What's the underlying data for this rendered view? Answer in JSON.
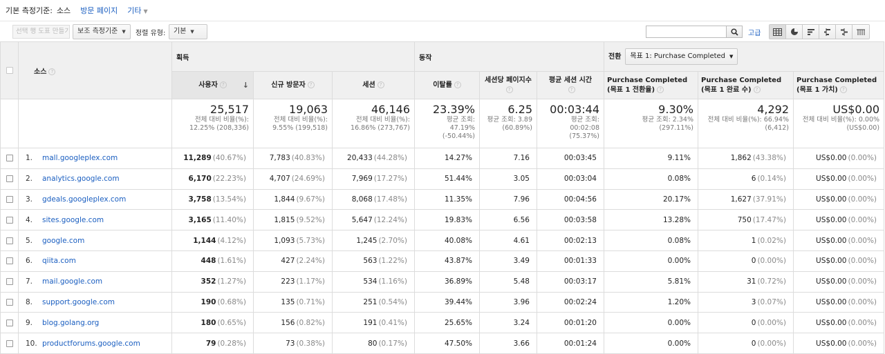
{
  "topbar": {
    "primary_dimension_label": "기본 측정기준:",
    "primary_dimension_current": "소스",
    "link_landing": "방문 페이지",
    "link_other": "기타"
  },
  "toolbar": {
    "create_row_chart": "선택 행 도표 만들기",
    "secondary_dimension": "보조 측정기준",
    "sort_type_label": "정렬 유형:",
    "sort_type_value": "기본",
    "search_placeholder": "",
    "advanced_link": "고급",
    "view_icons": [
      "table-view-icon",
      "pie-view-icon",
      "performance-view-icon",
      "comparison-view-icon",
      "term-cloud-view-icon",
      "pivot-view-icon"
    ]
  },
  "table": {
    "source_header": "소스",
    "groups": {
      "acquisition": "획득",
      "behavior": "동작",
      "conversion": "전환",
      "goal_select": "목표 1: Purchase Completed"
    },
    "columns": [
      "사용자",
      "신규 방문자",
      "세션",
      "이탈률",
      "세션당 페이지수",
      "평균 세션 시간",
      "Purchase Completed (목표 1 전환율)",
      "Purchase Completed (목표 1 완료 수)",
      "Purchase Completed (목표 1 가치)"
    ],
    "totals": [
      {
        "value": "25,517",
        "sub1": "전체 대비 비율(%):",
        "sub2": "12.25% (208,336)",
        "sub3": ""
      },
      {
        "value": "19,063",
        "sub1": "전체 대비 비율(%):",
        "sub2": "9.55% (199,518)",
        "sub3": ""
      },
      {
        "value": "46,146",
        "sub1": "전체 대비 비율(%):",
        "sub2": "16.86% (273,767)",
        "sub3": ""
      },
      {
        "value": "23.39%",
        "sub1": "평균 조회:",
        "sub2": "47.19%",
        "sub3": "(-50.44%)"
      },
      {
        "value": "6.25",
        "sub1": "평균 조회: 3.89",
        "sub2": "(60.89%)",
        "sub3": ""
      },
      {
        "value": "00:03:44",
        "sub1": "평균 조회:",
        "sub2": "00:02:08",
        "sub3": "(75.37%)"
      },
      {
        "value": "9.30%",
        "sub1": "평균 조회: 2.34%",
        "sub2": "(297.11%)",
        "sub3": ""
      },
      {
        "value": "4,292",
        "sub1": "전체 대비 비율(%): 66.94%",
        "sub2": "(6,412)",
        "sub3": ""
      },
      {
        "value": "US$0.00",
        "sub1": "전체 대비 비율(%): 0.00%",
        "sub2": "(US$0.00)",
        "sub3": ""
      }
    ],
    "rows": [
      {
        "idx": "1.",
        "source": "mall.googleplex.com",
        "users": "11,289",
        "users_pct": "(40.67%)",
        "new": "7,783",
        "new_pct": "(40.83%)",
        "sessions": "20,433",
        "sessions_pct": "(44.28%)",
        "bounce": "14.27%",
        "pps": "7.16",
        "dur": "00:03:45",
        "conv": "9.11%",
        "comp": "1,862",
        "comp_pct": "(43.38%)",
        "val": "US$0.00",
        "val_pct": "(0.00%)"
      },
      {
        "idx": "2.",
        "source": "analytics.google.com",
        "users": "6,170",
        "users_pct": "(22.23%)",
        "new": "4,707",
        "new_pct": "(24.69%)",
        "sessions": "7,969",
        "sessions_pct": "(17.27%)",
        "bounce": "51.44%",
        "pps": "3.05",
        "dur": "00:03:04",
        "conv": "0.08%",
        "comp": "6",
        "comp_pct": "(0.14%)",
        "val": "US$0.00",
        "val_pct": "(0.00%)"
      },
      {
        "idx": "3.",
        "source": "gdeals.googleplex.com",
        "users": "3,758",
        "users_pct": "(13.54%)",
        "new": "1,844",
        "new_pct": "(9.67%)",
        "sessions": "8,068",
        "sessions_pct": "(17.48%)",
        "bounce": "11.35%",
        "pps": "7.96",
        "dur": "00:04:56",
        "conv": "20.17%",
        "comp": "1,627",
        "comp_pct": "(37.91%)",
        "val": "US$0.00",
        "val_pct": "(0.00%)"
      },
      {
        "idx": "4.",
        "source": "sites.google.com",
        "users": "3,165",
        "users_pct": "(11.40%)",
        "new": "1,815",
        "new_pct": "(9.52%)",
        "sessions": "5,647",
        "sessions_pct": "(12.24%)",
        "bounce": "19.83%",
        "pps": "6.56",
        "dur": "00:03:58",
        "conv": "13.28%",
        "comp": "750",
        "comp_pct": "(17.47%)",
        "val": "US$0.00",
        "val_pct": "(0.00%)"
      },
      {
        "idx": "5.",
        "source": "google.com",
        "users": "1,144",
        "users_pct": "(4.12%)",
        "new": "1,093",
        "new_pct": "(5.73%)",
        "sessions": "1,245",
        "sessions_pct": "(2.70%)",
        "bounce": "40.08%",
        "pps": "4.61",
        "dur": "00:02:13",
        "conv": "0.08%",
        "comp": "1",
        "comp_pct": "(0.02%)",
        "val": "US$0.00",
        "val_pct": "(0.00%)"
      },
      {
        "idx": "6.",
        "source": "qiita.com",
        "users": "448",
        "users_pct": "(1.61%)",
        "new": "427",
        "new_pct": "(2.24%)",
        "sessions": "563",
        "sessions_pct": "(1.22%)",
        "bounce": "43.87%",
        "pps": "3.49",
        "dur": "00:01:33",
        "conv": "0.00%",
        "comp": "0",
        "comp_pct": "(0.00%)",
        "val": "US$0.00",
        "val_pct": "(0.00%)"
      },
      {
        "idx": "7.",
        "source": "mail.google.com",
        "users": "352",
        "users_pct": "(1.27%)",
        "new": "223",
        "new_pct": "(1.17%)",
        "sessions": "534",
        "sessions_pct": "(1.16%)",
        "bounce": "36.89%",
        "pps": "5.48",
        "dur": "00:03:17",
        "conv": "5.81%",
        "comp": "31",
        "comp_pct": "(0.72%)",
        "val": "US$0.00",
        "val_pct": "(0.00%)"
      },
      {
        "idx": "8.",
        "source": "support.google.com",
        "users": "190",
        "users_pct": "(0.68%)",
        "new": "135",
        "new_pct": "(0.71%)",
        "sessions": "251",
        "sessions_pct": "(0.54%)",
        "bounce": "39.44%",
        "pps": "3.96",
        "dur": "00:02:24",
        "conv": "1.20%",
        "comp": "3",
        "comp_pct": "(0.07%)",
        "val": "US$0.00",
        "val_pct": "(0.00%)"
      },
      {
        "idx": "9.",
        "source": "blog.golang.org",
        "users": "180",
        "users_pct": "(0.65%)",
        "new": "156",
        "new_pct": "(0.82%)",
        "sessions": "191",
        "sessions_pct": "(0.41%)",
        "bounce": "25.65%",
        "pps": "3.24",
        "dur": "00:01:20",
        "conv": "0.00%",
        "comp": "0",
        "comp_pct": "(0.00%)",
        "val": "US$0.00",
        "val_pct": "(0.00%)"
      },
      {
        "idx": "10.",
        "source": "productforums.google.com",
        "users": "79",
        "users_pct": "(0.28%)",
        "new": "73",
        "new_pct": "(0.38%)",
        "sessions": "80",
        "sessions_pct": "(0.17%)",
        "bounce": "47.50%",
        "pps": "3.66",
        "dur": "00:01:24",
        "conv": "0.00%",
        "comp": "0",
        "comp_pct": "(0.00%)",
        "val": "US$0.00",
        "val_pct": "(0.00%)"
      }
    ]
  },
  "colors": {
    "link": "#1a5ec0",
    "header_bg": "#f0f0f0",
    "border": "#dcdcdc"
  }
}
